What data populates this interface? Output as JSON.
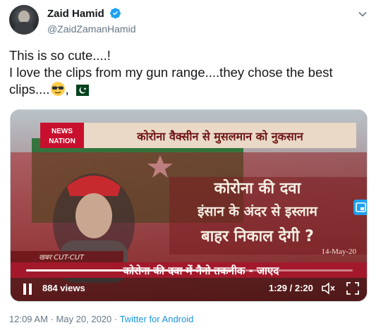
{
  "author": {
    "display_name": "Zaid Hamid",
    "handle": "@ZaidZamanHamid",
    "verified_icon": "verified-badge-icon"
  },
  "tweet": {
    "line1": "This is so cute....!",
    "line2": "I love the clips from my gun range....they chose the best",
    "line3_text": "clips....",
    "line3_sep": ",",
    "emojis": [
      "sunglasses-face-emoji",
      "pakistan-flag-emoji"
    ]
  },
  "video": {
    "logo_top": "NEWS",
    "logo_bottom": "NATION",
    "banner_text": "कोरोना वैक्सीन से मुसलमान को नुकसान",
    "headline_1": "कोरोना की दवा",
    "headline_2": "इंसान के अंदर से इस्लाम",
    "headline_3": "बाहर निकाल देगी ?",
    "date_stamp": "14-May-20",
    "segment_tag": "खबर CUT-CUT",
    "ticker": "कोरोना की दवा में नैनो तकनीक - जाएद",
    "views": "884 views",
    "timecode": "1:29 / 2:20",
    "progress": 0.636,
    "colors": {
      "red_bg": "#9e2a2b",
      "accent_blue": "#1da1f2"
    }
  },
  "meta": {
    "timestamp": "12:09 AM · May 20, 2020 · ",
    "source": "Twitter for Android"
  }
}
